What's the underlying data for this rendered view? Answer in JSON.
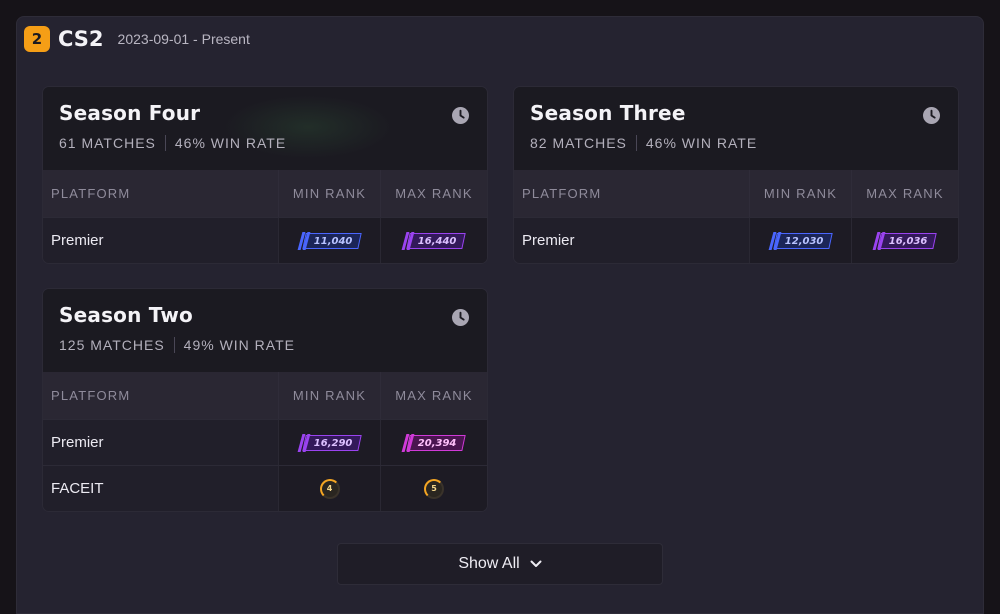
{
  "game": {
    "logo_text": "2",
    "title": "CS2",
    "dates": "2023-09-01 - Present",
    "logo_color": "#f59e16"
  },
  "table_headers": {
    "platform": "PLATFORM",
    "min_rank": "MIN RANK",
    "max_rank": "MAX RANK"
  },
  "seasons": [
    {
      "title": "Season Four",
      "matches": "61 MATCHES",
      "win_rate": "46% WIN RATE",
      "rows": [
        {
          "platform": "Premier",
          "min": "11,040",
          "min_color": "blue",
          "max": "16,440",
          "max_color": "purple"
        }
      ]
    },
    {
      "title": "Season Three",
      "matches": "82 MATCHES",
      "win_rate": "46% WIN RATE",
      "rows": [
        {
          "platform": "Premier",
          "min": "12,030",
          "min_color": "blue",
          "max": "16,036",
          "max_color": "purple"
        }
      ]
    },
    {
      "title": "Season Two",
      "matches": "125 MATCHES",
      "win_rate": "49% WIN RATE",
      "rows": [
        {
          "platform": "Premier",
          "min": "16,290",
          "min_color": "purple",
          "max": "20,394",
          "max_color": "pink"
        },
        {
          "platform": "FACEIT",
          "min": "4",
          "max": "5"
        }
      ]
    }
  ],
  "show_all": {
    "label": "Show All",
    "icon": "chevron-down-icon"
  },
  "icons": {
    "season_history": "clock-icon"
  }
}
